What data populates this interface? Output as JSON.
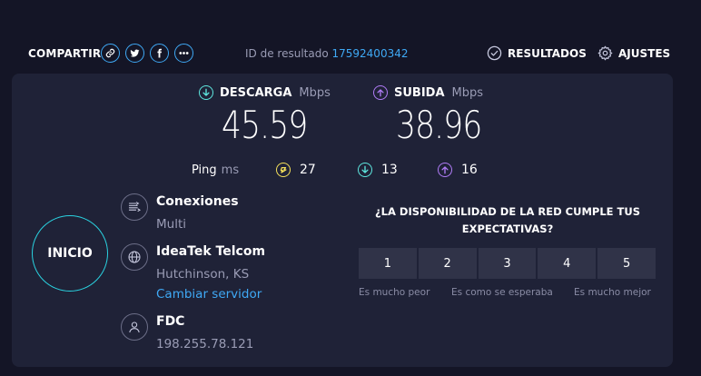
{
  "header": {
    "share_label": "COMPARTIR",
    "share_icons": [
      "link-icon",
      "twitter-icon",
      "facebook-icon",
      "more-icon"
    ],
    "result_id_label": "ID de resultado",
    "result_id_value": "17592400342",
    "results_label": "RESULTADOS",
    "settings_label": "AJUSTES"
  },
  "download": {
    "label": "DESCARGA",
    "unit": "Mbps",
    "value": "45.59",
    "color": "#5ee7df"
  },
  "upload": {
    "label": "SUBIDA",
    "unit": "Mbps",
    "value": "38.96",
    "color": "#b07cf7"
  },
  "ping": {
    "label": "Ping",
    "unit": "ms",
    "idle": "27",
    "download": "13",
    "upload": "16",
    "idle_color": "#f6e15b"
  },
  "start_button": {
    "label": "INICIO",
    "color": "#2ad2e0"
  },
  "connections": {
    "title": "Conexiones",
    "value": "Multi"
  },
  "server": {
    "name": "IdeaTek Telcom",
    "location": "Hutchinson, KS",
    "change_label": "Cambiar servidor"
  },
  "client": {
    "name": "FDC",
    "ip": "198.255.78.121"
  },
  "survey": {
    "question": "¿LA DISPONIBILIDAD DE LA RED CUMPLE TUS EXPECTATIVAS?",
    "options": [
      "1",
      "2",
      "3",
      "4",
      "5"
    ],
    "label_low": "Es mucho peor",
    "label_mid": "Es como se esperaba",
    "label_high": "Es mucho mejor"
  },
  "colors": {
    "accent": "#3fa9f5",
    "background": "#141526",
    "panel": "#1f2237"
  }
}
